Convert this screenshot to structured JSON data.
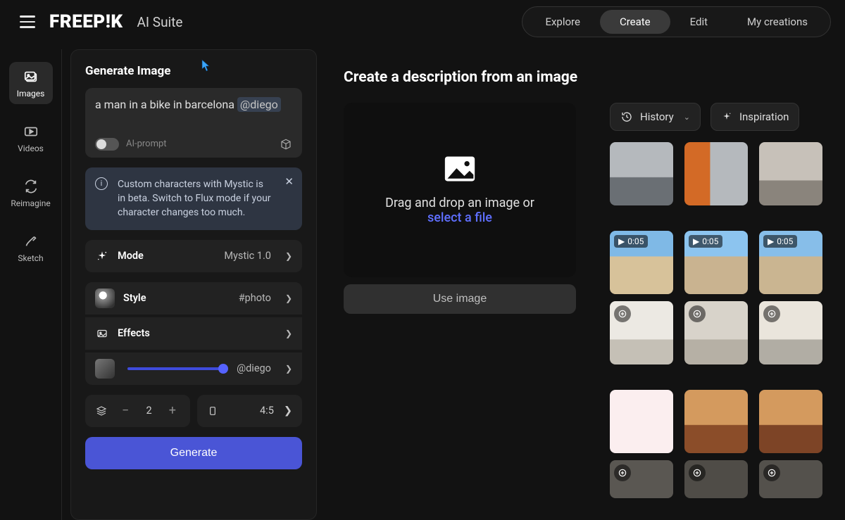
{
  "header": {
    "logo": "FREEP!K",
    "suite": "AI Suite",
    "nav": {
      "explore": "Explore",
      "create": "Create",
      "edit": "Edit",
      "my_creations": "My creations"
    }
  },
  "rail": {
    "images": "Images",
    "videos": "Videos",
    "reimagine": "Reimagine",
    "sketch": "Sketch"
  },
  "panel": {
    "title": "Generate Image",
    "prompt_text": "a man in a bike in barcelona ",
    "prompt_mention": "@diego",
    "ai_prompt": "AI-prompt",
    "notice": "Custom characters with Mystic is in beta. Switch to Flux mode if your character changes too much.",
    "mode": {
      "label": "Mode",
      "value": "Mystic 1.0"
    },
    "style": {
      "label": "Style",
      "value": "#photo"
    },
    "effects": {
      "label": "Effects"
    },
    "character": {
      "value": "@diego"
    },
    "count": "2",
    "aspect": "4:5",
    "generate": "Generate"
  },
  "content": {
    "heading": "Create a description from an image",
    "drop_line": "Drag and drop an image or",
    "select_file": "select a file",
    "use_image": "Use image",
    "history": "History",
    "inspiration": "Inspiration",
    "video_badge": "0:05"
  }
}
